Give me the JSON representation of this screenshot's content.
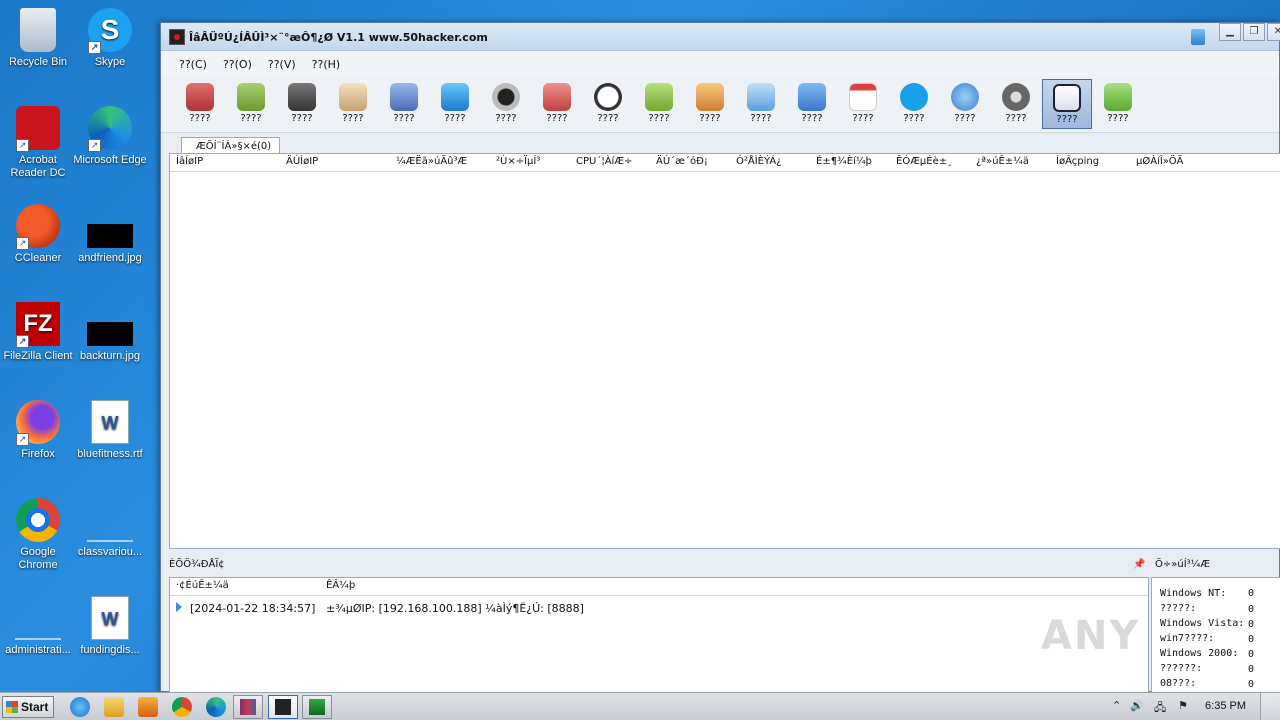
{
  "desktop": {
    "icons": [
      {
        "label": "Recycle Bin"
      },
      {
        "label": "Skype"
      },
      {
        "label": "Acrobat Reader DC"
      },
      {
        "label": "Microsoft Edge"
      },
      {
        "label": "CCleaner"
      },
      {
        "label": "andfriend.jpg"
      },
      {
        "label": "FileZilla Client"
      },
      {
        "label": "backturn.jpg"
      },
      {
        "label": "Firefox"
      },
      {
        "label": "bluefitness.rtf"
      },
      {
        "label": "Google Chrome"
      },
      {
        "label": "classvariou..."
      },
      {
        "label": "administrati..."
      },
      {
        "label": "fundingdis..."
      }
    ]
  },
  "window": {
    "title": "ÎâÂÜºÚ¿ÍÂÛÌ³×¨°æÔ¶¿Ø V1.1 www.50hacker.com",
    "controls": {
      "minimize": "▁",
      "restore": "❐",
      "close": "✕"
    },
    "menu": [
      "??(C)",
      "??(O)",
      "??(V)",
      "??(H)"
    ],
    "toolbar": [
      "????",
      "????",
      "????",
      "????",
      "????",
      "????",
      "????",
      "????",
      "????",
      "????",
      "????",
      "????",
      "????",
      "????",
      "????",
      "????",
      "????",
      "????",
      "????"
    ],
    "tab": "ÆÕÍ¨ÍÁ»§×é(0)",
    "columns": [
      "ÍâÍøIP",
      "ÄÚÍøIP",
      "¼ÆËã»úÃû³Æ",
      "²Ù×÷ÏµÍ³",
      "CPU´¦ÀíÆ÷",
      "ÄÚ´æ´óÐ¡",
      "Ó²ÅÌÈÝÁ¿",
      "É±¶¾Èí¼þ",
      "ÊÓÆµÉè±¸",
      "¿ª»úÊ±¼ä",
      "ÍøÂçping",
      "µØÀíÎ»ÖÃ"
    ]
  },
  "log": {
    "title": "ÈÕÖ¾ÐÅÏ¢",
    "pin": "📌",
    "columns": [
      "·¢ÉúÊ±¼ä",
      "ÊÂ¼þ"
    ],
    "rows": [
      {
        "time": "[2024-01-22 18:34:57]",
        "event": "±¾µØIP: [192.168.100.188] ¼àÌý¶Ë¿Ú: [8888]"
      }
    ]
  },
  "stats": {
    "title": "Ö÷»úÍ³¼Æ",
    "items": [
      {
        "label": "Windows NT:",
        "value": "0"
      },
      {
        "label": "?????:",
        "value": "0"
      },
      {
        "label": "Windows Vista:",
        "value": "0"
      },
      {
        "label": "win7????:",
        "value": "0"
      },
      {
        "label": "Windows 2000:",
        "value": "0"
      },
      {
        "label": "??????:",
        "value": "0"
      },
      {
        "label": "08???:",
        "value": "0"
      }
    ]
  },
  "watermark": "ANY",
  "taskbar": {
    "start": "Start",
    "clock": "6:35 PM"
  }
}
